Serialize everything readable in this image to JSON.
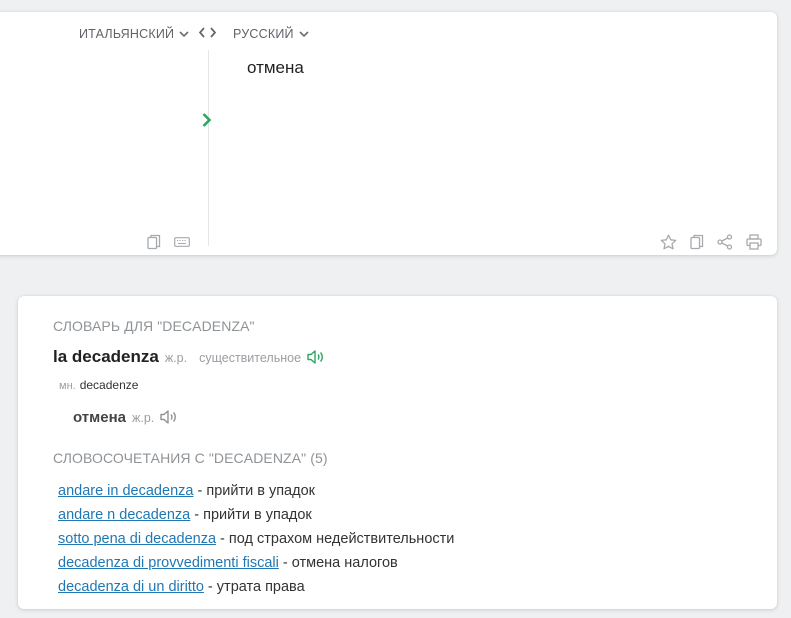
{
  "translator": {
    "source_language": "ИТАЛЬЯНСКИЙ",
    "target_language": "РУССКИЙ",
    "output_text": "отмена",
    "accent_color": "#2aa65f"
  },
  "dictionary": {
    "title": "СЛОВАРЬ ДЛЯ \"DECADENZA\"",
    "entry": {
      "word": "la decadenza",
      "gender": "ж.р.",
      "part_of_speech": "существительное",
      "plural_label": "мн.",
      "plural_form": "decadenze"
    },
    "translation": {
      "word": "отмена",
      "gender": "ж.р."
    },
    "phrases_title": "СЛОВОСОЧЕТАНИЯ С \"DECADENZA\" (5)",
    "phrases": [
      {
        "source": "andare in decadenza",
        "separator": " - ",
        "target": "прийти в упадок"
      },
      {
        "source": "andare n decadenza",
        "separator": " - ",
        "target": "прийти в упадок"
      },
      {
        "source": "sotto pena di decadenza",
        "separator": " - ",
        "target": "под страхом недействительности"
      },
      {
        "source": "decadenza di provvedimenti fiscali",
        "separator": " - ",
        "target": "отмена налогов"
      },
      {
        "source": "decadenza di un diritto",
        "separator": " - ",
        "target": "утрата права"
      }
    ],
    "link_color": "#1f78b4"
  }
}
